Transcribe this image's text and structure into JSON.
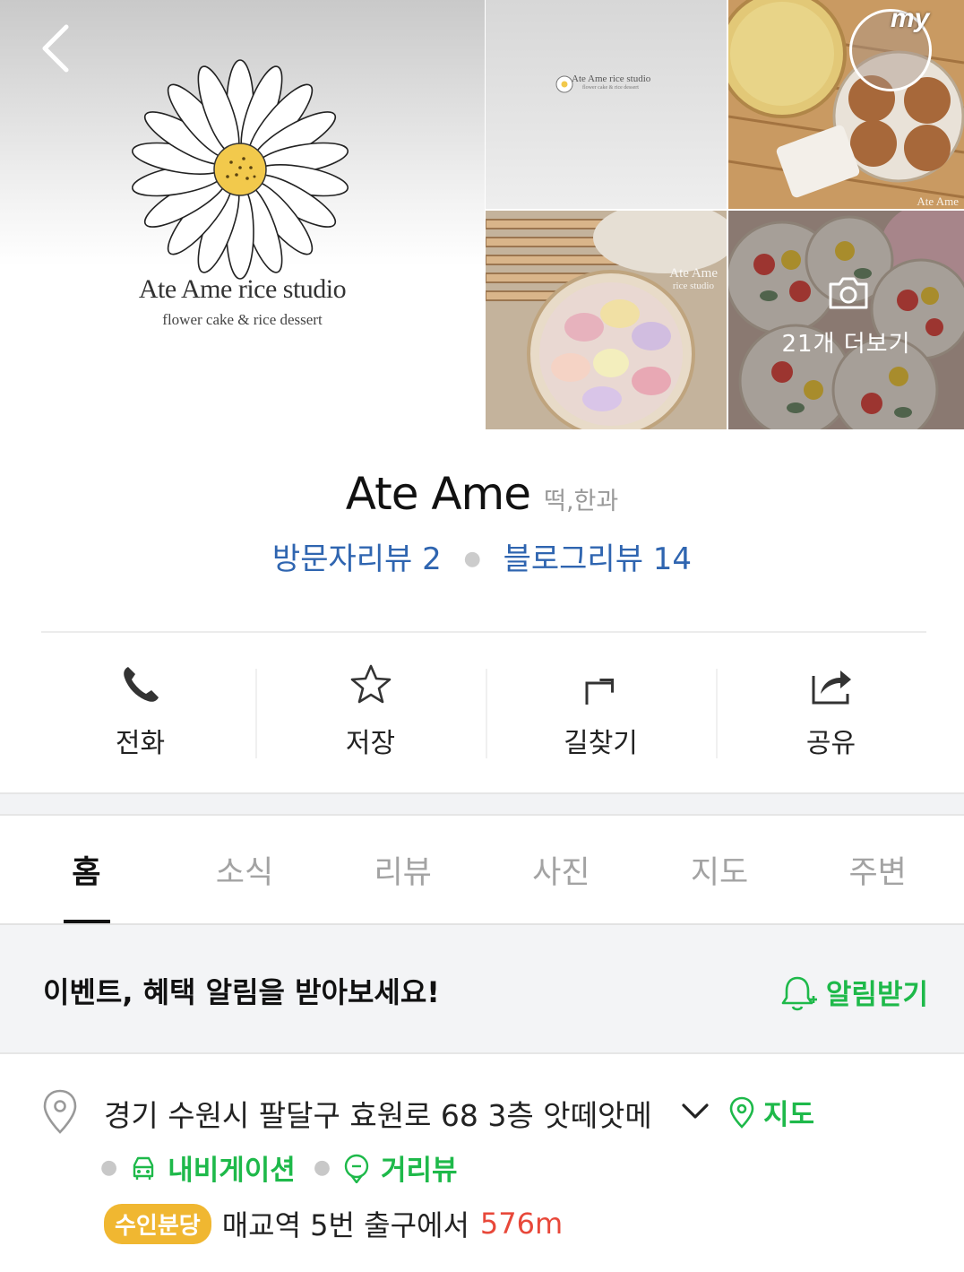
{
  "photos": {
    "logo_name": "Ate Ame rice studio",
    "logo_sub": "flower cake & rice dessert",
    "mini_logo_name": "Ate Ame rice studio",
    "mini_logo_sub": "flower cake & rice dessert",
    "watermark_1": "Ate Ame",
    "watermark_2": "Ate Ame",
    "watermark_2_sub": "rice studio",
    "my_label": "my",
    "more_label": "21개 더보기"
  },
  "place": {
    "name": "Ate Ame",
    "category": "떡,한과",
    "visitor_reviews": "방문자리뷰 2",
    "blog_reviews": "블로그리뷰 14"
  },
  "actions": [
    {
      "label": "전화",
      "icon": "phone-icon"
    },
    {
      "label": "저장",
      "icon": "star-icon"
    },
    {
      "label": "길찾기",
      "icon": "directions-icon"
    },
    {
      "label": "공유",
      "icon": "share-icon"
    }
  ],
  "tabs": [
    {
      "label": "홈",
      "active": true
    },
    {
      "label": "소식"
    },
    {
      "label": "리뷰"
    },
    {
      "label": "사진"
    },
    {
      "label": "지도"
    },
    {
      "label": "주변"
    }
  ],
  "notify": {
    "text": "이벤트, 혜택 알림을 받아보세요!",
    "button": "알림받기"
  },
  "info": {
    "address": "경기 수원시 팔달구 효원로 68 3층 앗떼앗메",
    "map_link": "지도",
    "navigation_link": "내비게이션",
    "street_view_link": "거리뷰",
    "subway_line": "수인분당",
    "subway_text": "매교역 5번 출구에서",
    "subway_distance": "576m"
  },
  "colors": {
    "link_blue": "#2f65b0",
    "accent_green": "#1eb94a",
    "subway_yellow": "#f0b731",
    "distance_red": "#e8483a"
  }
}
